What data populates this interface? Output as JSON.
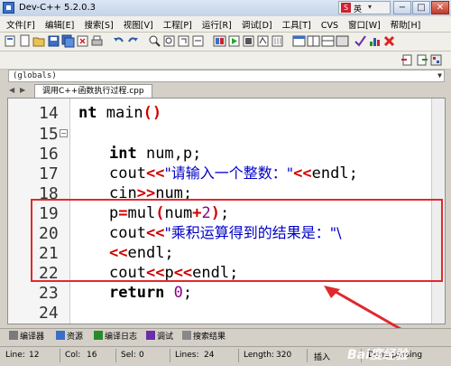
{
  "window": {
    "title": "Dev-C++ 5.2.0.3",
    "ime_lang": "英",
    "minimize": "−",
    "maximize": "□",
    "close": "✕"
  },
  "menu": [
    "文件[F]",
    "编辑[E]",
    "搜索[S]",
    "视图[V]",
    "工程[P]",
    "运行[R]",
    "调试[D]",
    "工具[T]",
    "CVS",
    "窗口[W]",
    "帮助[H]"
  ],
  "scope_combo": "(globals)",
  "file_tab": "调用C++函数执行过程.cpp",
  "code_lines": [
    {
      "num": "14",
      "text": "nt main()",
      "fold": false
    },
    {
      "num": "15",
      "text": "",
      "fold": true
    },
    {
      "num": "16",
      "text": "int num,p;",
      "fold": false
    },
    {
      "num": "17",
      "text": "cout<<\"请输入一个整数：\"<<endl;",
      "fold": false
    },
    {
      "num": "18",
      "text": "cin>>num;",
      "fold": false
    },
    {
      "num": "19",
      "text": "p=mul(num+2);",
      "fold": false
    },
    {
      "num": "20",
      "text": "cout<<\"乘积运算得到的结果是：\"\\",
      "fold": false
    },
    {
      "num": "21",
      "text": "<<endl;",
      "fold": false
    },
    {
      "num": "22",
      "text": "cout<<p<<endl;",
      "fold": false
    },
    {
      "num": "23",
      "text": "return 0;",
      "fold": false
    },
    {
      "num": "24",
      "text": "",
      "fold": false
    }
  ],
  "bottom_tabs": [
    "编译器",
    "资源",
    "编译日志",
    "调试",
    "搜索结果"
  ],
  "status": {
    "line_label": "Line:",
    "line": "12",
    "col_label": "Col:",
    "col": "16",
    "sel_label": "Sel:",
    "sel": "0",
    "lines_label": "Lines:",
    "lines": "24",
    "length_label": "Length:",
    "length": "320",
    "mode": "插入",
    "state": "Done parsing"
  },
  "watermark": "Bai度经验",
  "colors": {
    "highlight": "#e0292e",
    "operator": "#d00000",
    "string": "#0000c8"
  }
}
